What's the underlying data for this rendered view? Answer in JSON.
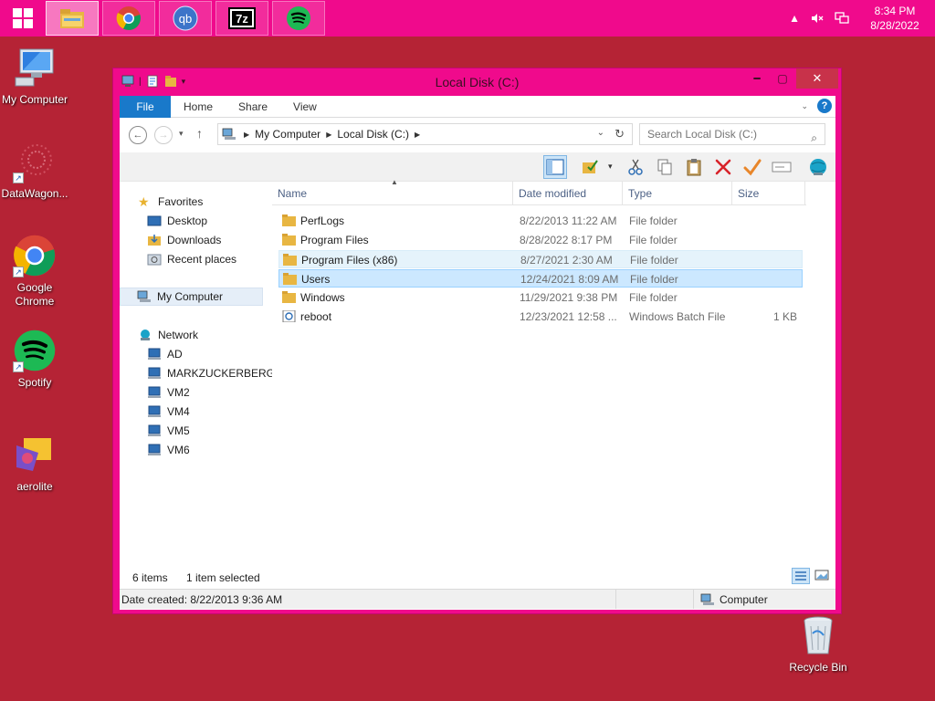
{
  "taskbar": {
    "apps": [
      {
        "name": "File Explorer",
        "icon": "file-explorer-icon",
        "active": true
      },
      {
        "name": "Google Chrome",
        "icon": "chrome-icon"
      },
      {
        "name": "qBittorrent",
        "icon": "qbittorrent-icon",
        "label": "qb"
      },
      {
        "name": "7-Zip",
        "icon": "7zip-icon",
        "label": "7z"
      },
      {
        "name": "Spotify",
        "icon": "spotify-icon"
      }
    ],
    "clock": {
      "time": "8:34 PM",
      "date": "8/28/2022"
    }
  },
  "desktop": {
    "icons": [
      {
        "label": "My Computer",
        "icon": "computer-icon"
      },
      {
        "label": "DataWagon...",
        "icon": "datawagon-icon"
      },
      {
        "label": "Google Chrome",
        "icon": "chrome-icon"
      },
      {
        "label": "Spotify",
        "icon": "spotify-icon"
      },
      {
        "label": "aerolite",
        "icon": "aerolite-icon"
      },
      {
        "label": "Recycle Bin",
        "icon": "recycle-bin-icon"
      }
    ]
  },
  "window": {
    "title": "Local Disk (C:)",
    "ribbon_tabs": [
      "File",
      "Home",
      "Share",
      "View"
    ],
    "address": {
      "crumbs": [
        "My Computer",
        "Local Disk (C:)"
      ]
    },
    "search": {
      "placeholder": "Search Local Disk (C:)"
    },
    "navigation": {
      "favorites": {
        "label": "Favorites",
        "items": [
          "Desktop",
          "Downloads",
          "Recent places"
        ]
      },
      "computer": {
        "label": "My Computer"
      },
      "network": {
        "label": "Network",
        "items": [
          "AD",
          "MARKZUCKERBERG",
          "VM2",
          "VM4",
          "VM5",
          "VM6"
        ]
      }
    },
    "columns": [
      "Name",
      "Date modified",
      "Type",
      "Size"
    ],
    "files": [
      {
        "name": "PerfLogs",
        "date": "8/22/2013 11:22 AM",
        "type": "File folder",
        "size": "",
        "kind": "folder"
      },
      {
        "name": "Program Files",
        "date": "8/28/2022 8:17 PM",
        "type": "File folder",
        "size": "",
        "kind": "folder"
      },
      {
        "name": "Program Files (x86)",
        "date": "8/27/2021 2:30 AM",
        "type": "File folder",
        "size": "",
        "kind": "folder",
        "state": "hover"
      },
      {
        "name": "Users",
        "date": "12/24/2021 8:09 AM",
        "type": "File folder",
        "size": "",
        "kind": "folder",
        "state": "selected"
      },
      {
        "name": "Windows",
        "date": "11/29/2021 9:38 PM",
        "type": "File folder",
        "size": "",
        "kind": "folder"
      },
      {
        "name": "reboot",
        "date": "12/23/2021 12:58 ...",
        "type": "Windows Batch File",
        "size": "1 KB",
        "kind": "batch"
      }
    ],
    "status": {
      "count": "6 items",
      "selected": "1 item selected",
      "details": "Date created: 8/22/2013 9:36 AM",
      "location": "Computer"
    }
  }
}
